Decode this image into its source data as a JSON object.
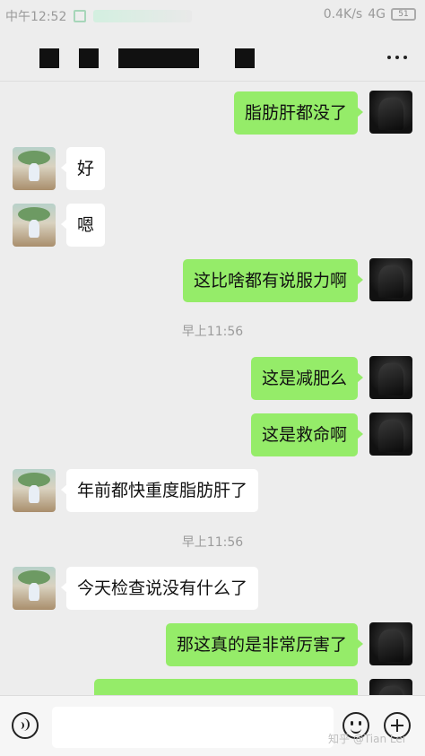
{
  "status_bar": {
    "time": "中午12:52",
    "network": "0.4K/s",
    "signal": "4G",
    "battery": "51"
  },
  "header": {
    "more_icon": "more-dots-icon"
  },
  "messages": [
    {
      "side": "out",
      "text": "脂肪肝都没了"
    },
    {
      "side": "in",
      "text": "好"
    },
    {
      "side": "in",
      "text": "嗯"
    },
    {
      "side": "out",
      "text": "这比啥都有说服力啊"
    },
    {
      "type": "time",
      "text": "早上11:56"
    },
    {
      "side": "out",
      "text": "这是减肥么"
    },
    {
      "side": "out",
      "text": "这是救命啊"
    },
    {
      "side": "in",
      "text": "年前都快重度脂肪肝了"
    },
    {
      "type": "time",
      "text": "早上11:56"
    },
    {
      "side": "in",
      "text": "今天检查说没有什么了"
    },
    {
      "side": "out",
      "text": "那这真的是非常厉害了"
    }
  ],
  "input_bar": {
    "placeholder": "",
    "voice_icon": "voice-icon",
    "emoji_icon": "emoji-icon",
    "plus_icon": "plus-icon"
  },
  "watermark": "知乎 @Tian Lei",
  "colors": {
    "outgoing_bubble": "#95ec69",
    "incoming_bubble": "#ffffff",
    "background": "#ededed"
  }
}
